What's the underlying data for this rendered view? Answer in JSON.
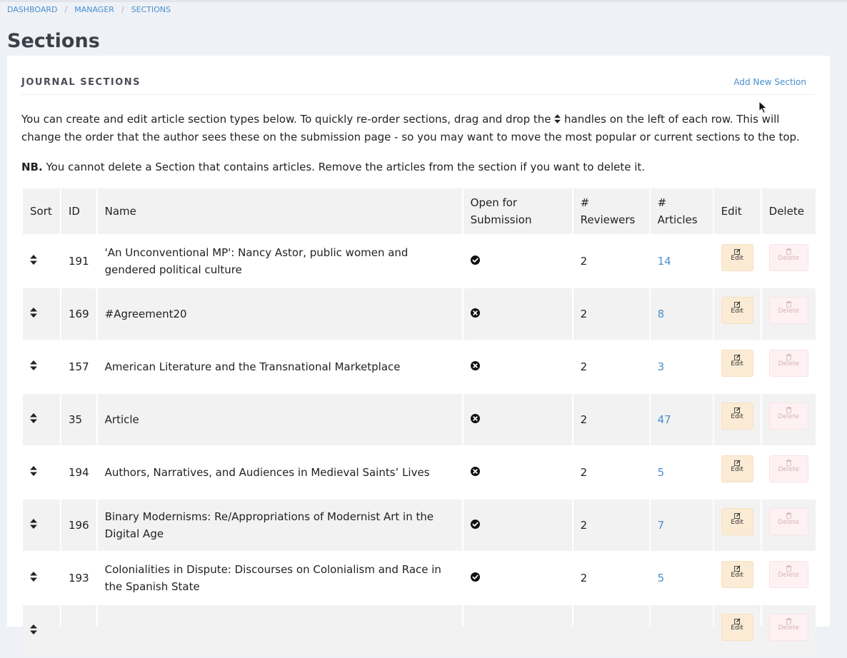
{
  "breadcrumb": [
    {
      "label": "DASHBOARD"
    },
    {
      "label": "MANAGER"
    },
    {
      "label": "SECTIONS"
    }
  ],
  "breadcrumb_separator": "/",
  "page_title": "Sections",
  "card": {
    "title": "JOURNAL SECTIONS",
    "add_link": "Add New Section"
  },
  "intro": {
    "before_icon": "You can create and edit article section types below. To quickly re-order sections, drag and drop the ",
    "icon": "sort-icon",
    "after_icon": " handles on the left of each row. This will change the order that the author sees these on the submission page - so you may want to move the most popular or current sections to the top."
  },
  "note": {
    "label": "NB.",
    "text": " You cannot delete a Section that contains articles. Remove the articles from the section if you want to delete it."
  },
  "table": {
    "headers": {
      "sort": "Sort",
      "id": "ID",
      "name": "Name",
      "open": "Open for Submission",
      "reviewers": "# Reviewers",
      "articles": "# Articles",
      "edit": "Edit",
      "delete": "Delete"
    },
    "edit_label": "Edit",
    "delete_label": "Delete",
    "rows": [
      {
        "id": "191",
        "name": "'An Unconventional MP': Nancy Astor, public women and gendered political culture",
        "open": true,
        "reviewers": "2",
        "articles": "14"
      },
      {
        "id": "169",
        "name": "#Agreement20",
        "open": false,
        "reviewers": "2",
        "articles": "8"
      },
      {
        "id": "157",
        "name": "American Literature and the Transnational Marketplace",
        "open": false,
        "reviewers": "2",
        "articles": "3"
      },
      {
        "id": "35",
        "name": "Article",
        "open": false,
        "reviewers": "2",
        "articles": "47"
      },
      {
        "id": "194",
        "name": "Authors, Narratives, and Audiences in Medieval Saints’ Lives",
        "open": false,
        "reviewers": "2",
        "articles": "5"
      },
      {
        "id": "196",
        "name": "Binary Modernisms: Re/Appropriations of Modernist Art in the Digital Age",
        "open": true,
        "reviewers": "2",
        "articles": "7"
      },
      {
        "id": "193",
        "name": "Colonialities in Dispute: Discourses on Colonialism and Race in the Spanish State",
        "open": true,
        "reviewers": "2",
        "articles": "5"
      },
      {
        "id": "",
        "name": "",
        "open": null,
        "reviewers": "",
        "articles": ""
      }
    ]
  },
  "icons": {
    "sort": "sort-icon",
    "open": "check-circle-icon",
    "closed": "times-circle-icon",
    "edit": "pencil-square-icon",
    "delete": "trash-icon"
  },
  "colors": {
    "link": "#4a8fce",
    "edit_button": "#fbebd4",
    "delete_button": "#fdf1f3",
    "row_alt": "#f2f2f2"
  }
}
